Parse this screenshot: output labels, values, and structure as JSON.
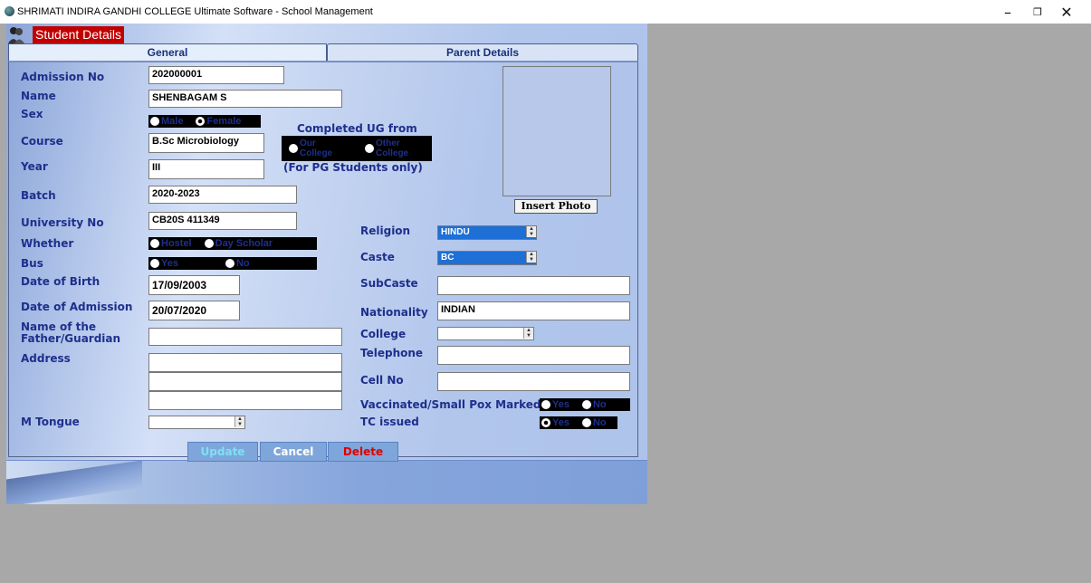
{
  "window": {
    "title": "SHRIMATI INDIRA GANDHI COLLEGE Ultimate Software - School Management",
    "controls": {
      "minimize": "–",
      "restore": "❐",
      "close": "✕"
    }
  },
  "form": {
    "title": "Student Details",
    "tabs": [
      "General",
      "Parent Details"
    ],
    "labels": {
      "admission_no": "Admission No",
      "name": "Name",
      "sex": "Sex",
      "course": "Course",
      "year": "Year",
      "batch": "Batch",
      "university_no": "University No",
      "whether": "Whether",
      "bus": "Bus",
      "dob": "Date of Birth",
      "doa": "Date of Admission",
      "father_line1": "Name of the",
      "father_line2": "Father/Guardian",
      "address": "Address",
      "mtongue": "M Tongue",
      "completed_ug": "Completed UG from",
      "pg_only": "(For PG Students only)",
      "religion": "Religion",
      "caste": "Caste",
      "subcaste": "SubCaste",
      "nationality": "Nationality",
      "college": "College",
      "telephone": "Telephone",
      "cellno": "Cell No",
      "vaccinated": "Vaccinated/Small Pox Marked",
      "tc_issued": "TC issued"
    },
    "values": {
      "admission_no": "202000001",
      "name": "SHENBAGAM S",
      "course": "B.Sc Microbiology",
      "year": "III",
      "batch": "2020-2023",
      "university_no": "CB20S 411349",
      "dob": "17/09/2003",
      "doa": "20/07/2020",
      "father": "",
      "address1": "",
      "address2": "",
      "address3": "",
      "mtongue": "",
      "religion": "HINDU",
      "caste": "BC",
      "subcaste": "",
      "nationality": "INDIAN",
      "college": "",
      "telephone": "",
      "cellno": ""
    },
    "radios": {
      "sex": [
        {
          "label": "Male",
          "selected": false
        },
        {
          "label": "Female",
          "selected": true
        }
      ],
      "ug": [
        {
          "label": "Our College",
          "selected": false
        },
        {
          "label": "Other College",
          "selected": false
        }
      ],
      "whether": [
        {
          "label": "Hostel",
          "selected": false
        },
        {
          "label": "Day Scholar",
          "selected": false
        }
      ],
      "bus": [
        {
          "label": "Yes",
          "selected": false
        },
        {
          "label": "No",
          "selected": false
        }
      ],
      "vaccinated": [
        {
          "label": "Yes",
          "selected": false
        },
        {
          "label": "No",
          "selected": false
        }
      ],
      "tc": [
        {
          "label": "Yes",
          "selected": true
        },
        {
          "label": "No",
          "selected": false
        }
      ]
    },
    "buttons": {
      "insert_photo": "Insert Photo",
      "update": "Update",
      "cancel": "Cancel",
      "delete": "Delete"
    },
    "colors": {
      "label": "#1e2f8c",
      "title_bg": "#c00000",
      "selected_combo": "#1e6fd6"
    }
  }
}
